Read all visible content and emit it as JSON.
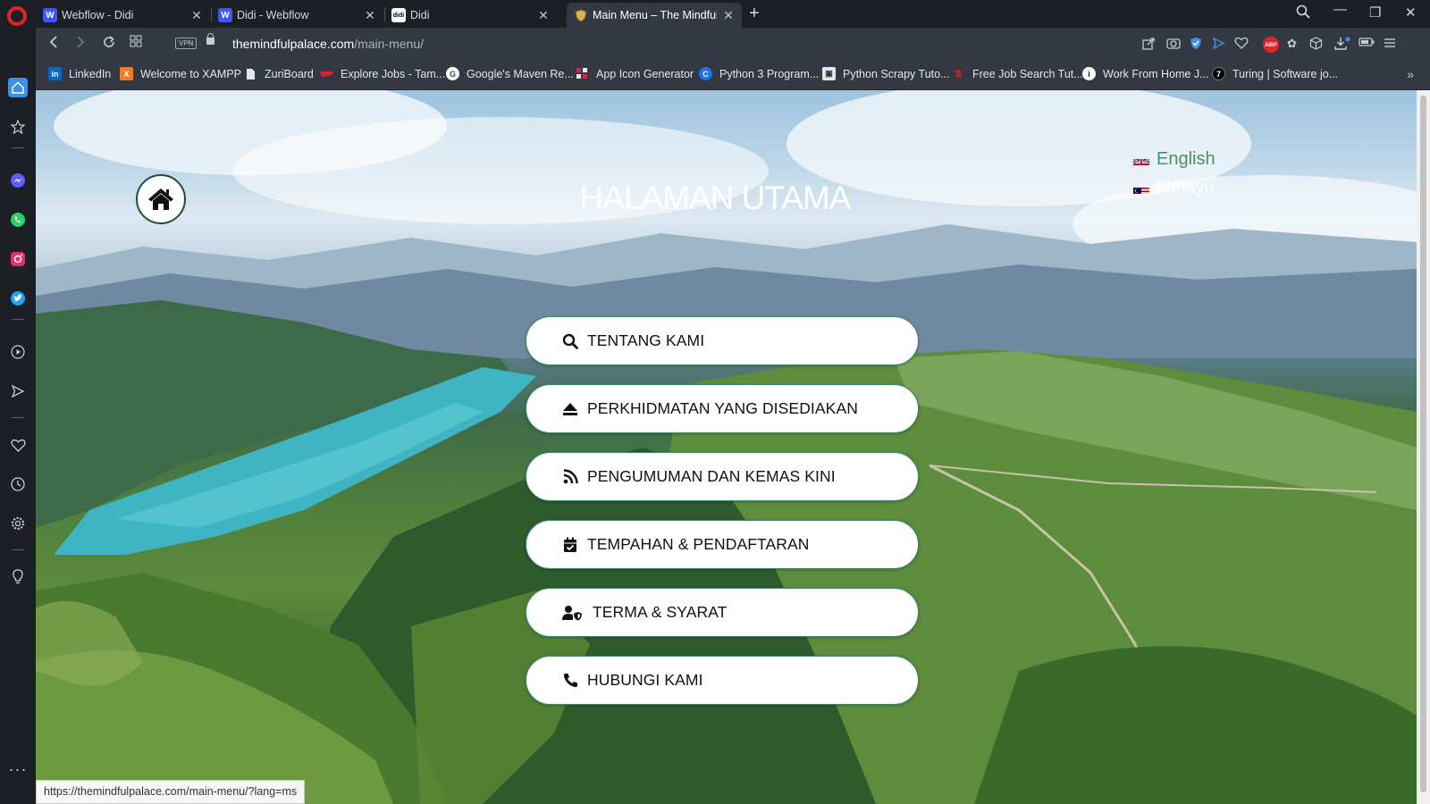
{
  "tabs": [
    {
      "title": "Webflow - Didi",
      "icon": "W",
      "icon_color": "#4353ff"
    },
    {
      "title": "Didi - Webflow",
      "icon": "W",
      "icon_color": "#4353ff"
    },
    {
      "title": "Didi",
      "icon": "didi",
      "icon_color": "#ffffff"
    },
    {
      "title": "Main Menu – The Mindful P",
      "icon": "shield",
      "icon_color": "#d9b24c"
    }
  ],
  "address": {
    "domain": "themindfulpalace.com",
    "path": "/main-menu/",
    "vpn_label": "VPN"
  },
  "extensions": {
    "abp_label": "ABP"
  },
  "bookmarks": [
    {
      "label": "LinkedIn",
      "icon": "in",
      "color": "#0a66c2"
    },
    {
      "label": "Welcome to XAMPP",
      "icon": "X",
      "color": "#fb7a24"
    },
    {
      "label": "ZuriBoard",
      "icon": "doc",
      "color": "#e4e6ea"
    },
    {
      "label": "Explore Jobs - Tam...",
      "icon": "ribbon",
      "color": "#e0242f"
    },
    {
      "label": "Google's Maven Re...",
      "icon": "G",
      "color": "#ffffff"
    },
    {
      "label": "App Icon Generator",
      "icon": "grid",
      "color": "#e0242f"
    },
    {
      "label": "Python 3 Program...",
      "icon": "C",
      "color": "#1a73e8"
    },
    {
      "label": "Python Scrapy Tuto...",
      "icon": "img",
      "color": "#e4e6ea"
    },
    {
      "label": "Free Job Search Tut...",
      "icon": "w",
      "color": "#e0242f"
    },
    {
      "label": "Work From Home J...",
      "icon": "i",
      "color": "#ffffff"
    },
    {
      "label": "Turing | Software jo...",
      "icon": "7",
      "color": "#000000"
    }
  ],
  "page": {
    "title": "HALAMAN UTAMA",
    "languages": [
      {
        "label": "English",
        "flag": "uk-flag"
      },
      {
        "label": "Melayu",
        "flag": "malaysia-flag"
      }
    ],
    "menu": [
      {
        "label": "TENTANG KAMI",
        "icon": "search-icon"
      },
      {
        "label": "PERKHIDMATAN YANG DISEDIAKAN",
        "icon": "eject-icon"
      },
      {
        "label": "PENGUMUMAN DAN KEMAS KINI",
        "icon": "rss-icon"
      },
      {
        "label": "TEMPAHAN & PENDAFTARAN",
        "icon": "calendar-check-icon"
      },
      {
        "label": "TERMA & SYARAT",
        "icon": "user-shield-icon"
      },
      {
        "label": "HUBUNGI KAMI",
        "icon": "phone-icon"
      }
    ]
  },
  "status_bar": {
    "url": "https://themindfulpalace.com/main-menu/?lang=ms"
  },
  "colors": {
    "accent_green": "#4a8f6b",
    "button_border": "#3a8a6a",
    "opera_red": "#e0242f"
  }
}
